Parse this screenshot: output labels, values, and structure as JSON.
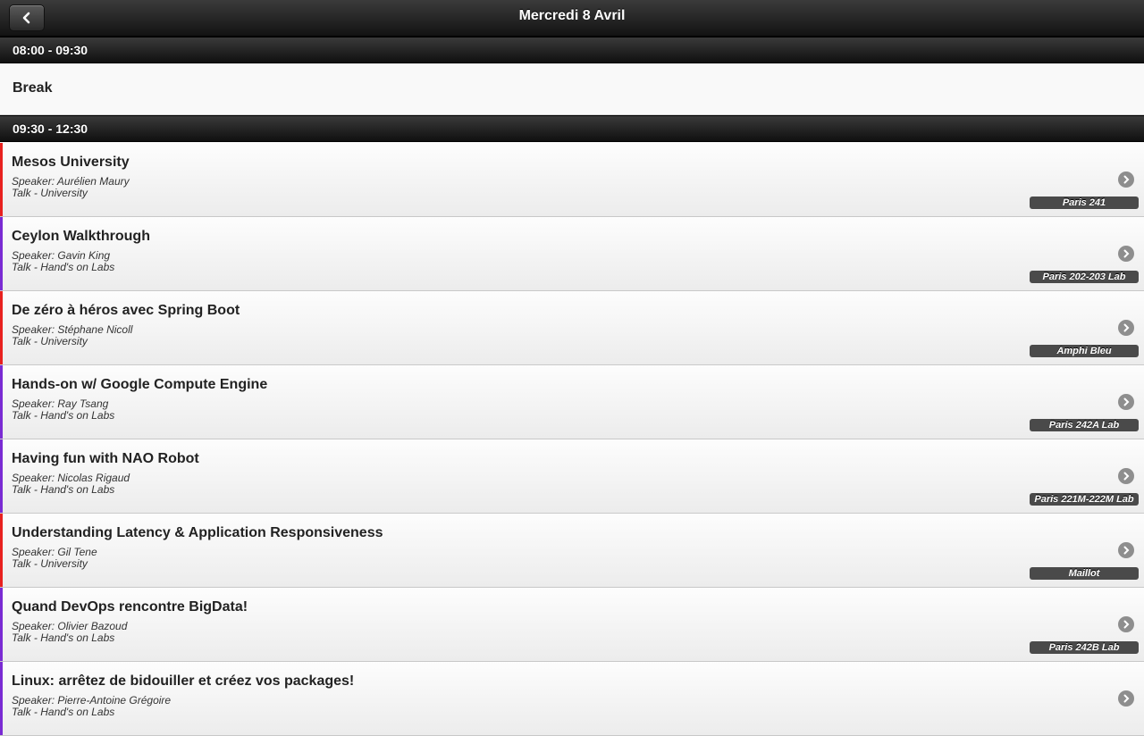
{
  "header": {
    "title": "Mercredi 8 Avril",
    "back_icon": "chevron-left-icon"
  },
  "slots": [
    {
      "time": "08:00 - 09:30"
    },
    {
      "time": "09:30 - 12:30"
    }
  ],
  "break_label": "Break",
  "colors": {
    "university": "#e8211f",
    "labs": "#7a2bd3",
    "room_badge": "#4a4a4a",
    "arrow": "#8e8e8e"
  },
  "sessions": [
    {
      "title": "Mesos University",
      "speaker": "Speaker: Aurélien Maury",
      "type": "Talk - University",
      "room": "Paris 241",
      "category": "university"
    },
    {
      "title": "Ceylon Walkthrough",
      "speaker": "Speaker: Gavin King",
      "type": "Talk - Hand's on Labs",
      "room": "Paris 202-203 Lab",
      "category": "labs"
    },
    {
      "title": "De zéro à héros avec Spring Boot",
      "speaker": "Speaker: Stéphane Nicoll",
      "type": "Talk - University",
      "room": "Amphi Bleu",
      "category": "university"
    },
    {
      "title": "Hands-on w/ Google Compute Engine",
      "speaker": "Speaker: Ray Tsang",
      "type": "Talk - Hand's on Labs",
      "room": "Paris 242A Lab",
      "category": "labs"
    },
    {
      "title": "Having fun with NAO Robot",
      "speaker": "Speaker: Nicolas Rigaud",
      "type": "Talk - Hand's on Labs",
      "room": "Paris 221M-222M Lab",
      "category": "labs"
    },
    {
      "title": "Understanding Latency & Application Responsiveness",
      "speaker": "Speaker: Gil Tene",
      "type": "Talk - University",
      "room": "Maillot",
      "category": "university"
    },
    {
      "title": "Quand DevOps rencontre BigData!",
      "speaker": "Speaker: Olivier Bazoud",
      "type": "Talk - Hand's on Labs",
      "room": "Paris 242B Lab",
      "category": "labs"
    },
    {
      "title": "Linux: arrêtez de bidouiller et créez vos packages!",
      "speaker": "Speaker: Pierre-Antoine Grégoire",
      "type": "Talk - Hand's on Labs",
      "room": "",
      "category": "labs"
    }
  ]
}
